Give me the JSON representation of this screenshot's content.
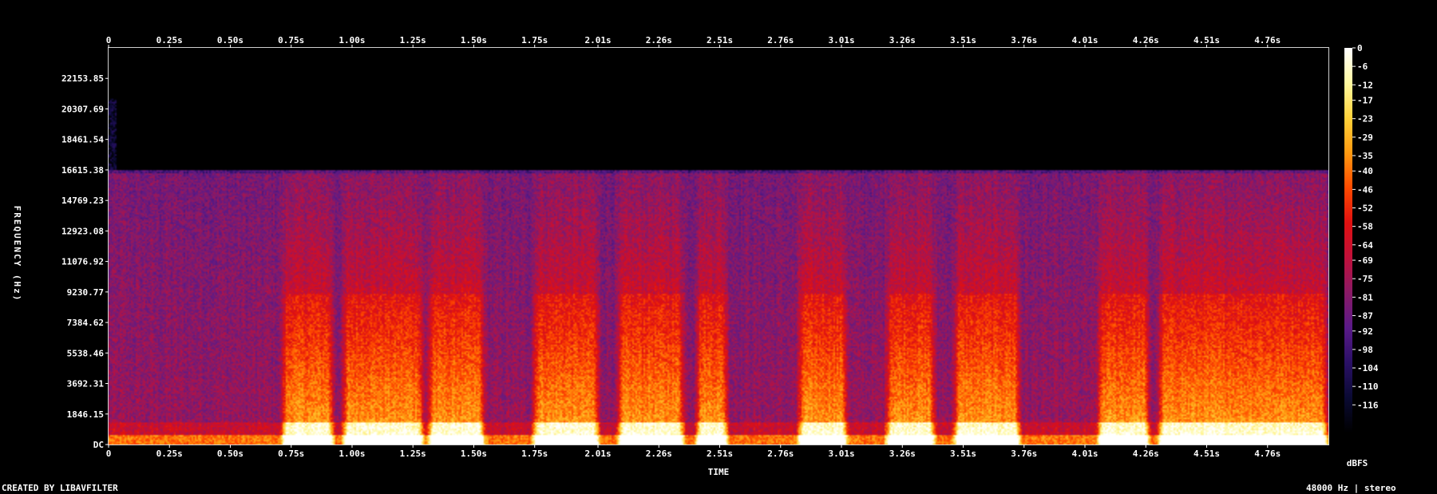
{
  "chart_data": {
    "type": "heatmap",
    "title": "",
    "xlabel": "TIME",
    "ylabel": "FREQUENCY (Hz)",
    "x_ticks": [
      "0",
      "0.25s",
      "0.50s",
      "0.75s",
      "1.00s",
      "1.25s",
      "1.50s",
      "1.75s",
      "2.01s",
      "2.26s",
      "2.51s",
      "2.76s",
      "3.01s",
      "3.26s",
      "3.51s",
      "3.76s",
      "4.01s",
      "4.26s",
      "4.51s",
      "4.76s"
    ],
    "x_tick_values": [
      0,
      0.25,
      0.5,
      0.75,
      1.0,
      1.25,
      1.5,
      1.75,
      2.01,
      2.26,
      2.51,
      2.76,
      3.01,
      3.26,
      3.51,
      3.76,
      4.01,
      4.26,
      4.51,
      4.76
    ],
    "xlim": [
      0,
      5.01
    ],
    "y_ticks": [
      "DC",
      "1846.15",
      "3692.31",
      "5538.46",
      "7384.62",
      "9230.77",
      "11076.92",
      "12923.08",
      "14769.23",
      "16615.38",
      "18461.54",
      "20307.69",
      "22153.85"
    ],
    "y_tick_values": [
      0,
      1846.15,
      3692.31,
      5538.46,
      7384.62,
      9230.77,
      11076.92,
      12923.08,
      14769.23,
      16615.38,
      18461.54,
      20307.69,
      22153.85
    ],
    "ylim": [
      0,
      24000
    ],
    "cutoff_hz": 16615,
    "colorbar_label": "dBFS",
    "colorbar_ticks": [
      "0",
      "-6",
      "-12",
      "-17",
      "-23",
      "-29",
      "-35",
      "-40",
      "-46",
      "-52",
      "-58",
      "-64",
      "-69",
      "-75",
      "-81",
      "-87",
      "-92",
      "-98",
      "-104",
      "-110",
      "-116"
    ],
    "colorbar_values": [
      0,
      -6,
      -12,
      -17,
      -23,
      -29,
      -35,
      -40,
      -46,
      -52,
      -58,
      -64,
      -69,
      -75,
      -81,
      -87,
      -92,
      -98,
      -104,
      -110,
      -116
    ],
    "colormap": [
      "#ffffff",
      "#fff9a0",
      "#ffd23a",
      "#ff9a10",
      "#ff4a00",
      "#e01010",
      "#c0103a",
      "#8a1a66",
      "#5a1a88",
      "#2a1066",
      "#0a0a33",
      "#000000"
    ],
    "loud_segments_s": [
      [
        0.7,
        0.93
      ],
      [
        0.95,
        1.3
      ],
      [
        1.3,
        1.55
      ],
      [
        1.73,
        2.02
      ],
      [
        2.08,
        2.37
      ],
      [
        2.4,
        2.55
      ],
      [
        2.82,
        3.04
      ],
      [
        3.18,
        3.4
      ],
      [
        3.46,
        3.75
      ],
      [
        4.05,
        4.28
      ],
      [
        4.3,
        5.01
      ]
    ],
    "legend": ""
  },
  "footer": {
    "left": "CREATED BY LIBAVFILTER",
    "right": "48000 Hz | stereo"
  }
}
